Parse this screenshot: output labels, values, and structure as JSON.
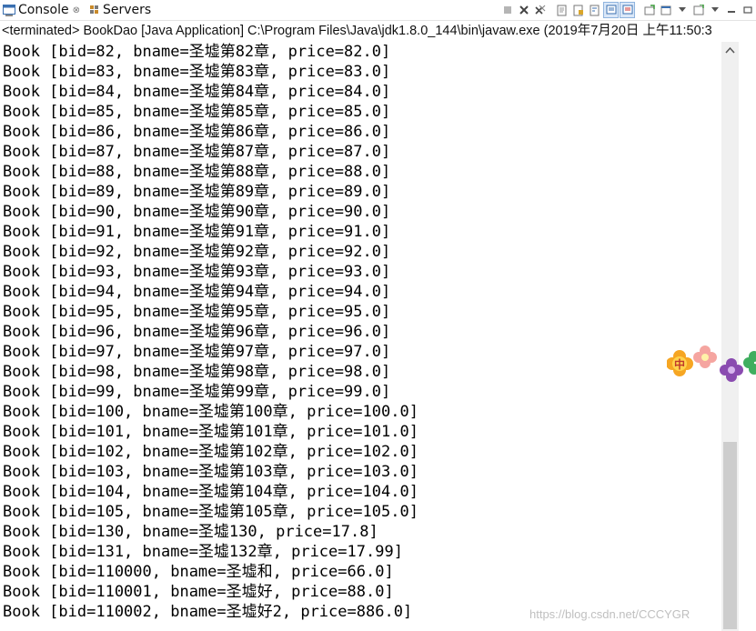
{
  "tabs": {
    "console_label": "Console",
    "console_close": "⊗",
    "servers_label": "Servers"
  },
  "status_text": "<terminated> BookDao [Java Application] C:\\Program Files\\Java\\jdk1.8.0_144\\bin\\javaw.exe (2019年7月20日 上午11:50:3",
  "lines": [
    "Book [bid=82, bname=圣墟第82章, price=82.0]",
    "Book [bid=83, bname=圣墟第83章, price=83.0]",
    "Book [bid=84, bname=圣墟第84章, price=84.0]",
    "Book [bid=85, bname=圣墟第85章, price=85.0]",
    "Book [bid=86, bname=圣墟第86章, price=86.0]",
    "Book [bid=87, bname=圣墟第87章, price=87.0]",
    "Book [bid=88, bname=圣墟第88章, price=88.0]",
    "Book [bid=89, bname=圣墟第89章, price=89.0]",
    "Book [bid=90, bname=圣墟第90章, price=90.0]",
    "Book [bid=91, bname=圣墟第91章, price=91.0]",
    "Book [bid=92, bname=圣墟第92章, price=92.0]",
    "Book [bid=93, bname=圣墟第93章, price=93.0]",
    "Book [bid=94, bname=圣墟第94章, price=94.0]",
    "Book [bid=95, bname=圣墟第95章, price=95.0]",
    "Book [bid=96, bname=圣墟第96章, price=96.0]",
    "Book [bid=97, bname=圣墟第97章, price=97.0]",
    "Book [bid=98, bname=圣墟第98章, price=98.0]",
    "Book [bid=99, bname=圣墟第99章, price=99.0]",
    "Book [bid=100, bname=圣墟第100章, price=100.0]",
    "Book [bid=101, bname=圣墟第101章, price=101.0]",
    "Book [bid=102, bname=圣墟第102章, price=102.0]",
    "Book [bid=103, bname=圣墟第103章, price=103.0]",
    "Book [bid=104, bname=圣墟第104章, price=104.0]",
    "Book [bid=105, bname=圣墟第105章, price=105.0]",
    "Book [bid=130, bname=圣墟130, price=17.8]",
    "Book [bid=131, bname=圣墟132章, price=17.99]",
    "Book [bid=110000, bname=圣墟和, price=66.0]",
    "Book [bid=110001, bname=圣墟好, price=88.0]",
    "Book [bid=110002, bname=圣墟好2, price=886.0]"
  ],
  "watermark": "https://blog.csdn.net/CCCYGR",
  "decor_char": "中",
  "colors": {
    "console_icon": "#3a6fb0",
    "decor_orange": "#f6a623",
    "decor_pink": "#f5a5a0",
    "decor_purple": "#8a4bb0",
    "decor_green": "#3fae5f"
  }
}
